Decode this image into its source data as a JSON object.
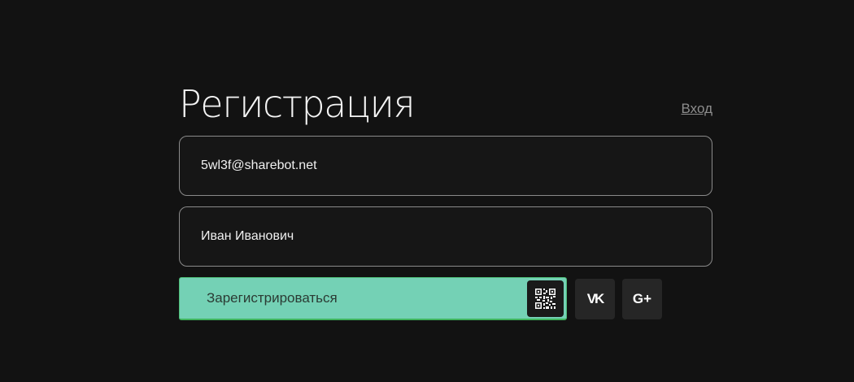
{
  "header": {
    "title": "Регистрация",
    "login_link": "Вход"
  },
  "form": {
    "email_value": "5wl3f@sharebot.net",
    "name_value": "Иван Иванович",
    "register_label": "Зарегистрироваться"
  },
  "social": {
    "vk_label": "VK",
    "google_label": "G+"
  },
  "icons": {
    "qr": "qr-code-icon",
    "vk": "vk-icon",
    "google": "google-plus-icon"
  },
  "colors": {
    "background": "#121212",
    "accent": "#74d1b5",
    "accent_border": "#3fb45c",
    "field_border": "#8a8a8a",
    "social_bg": "#262626"
  }
}
